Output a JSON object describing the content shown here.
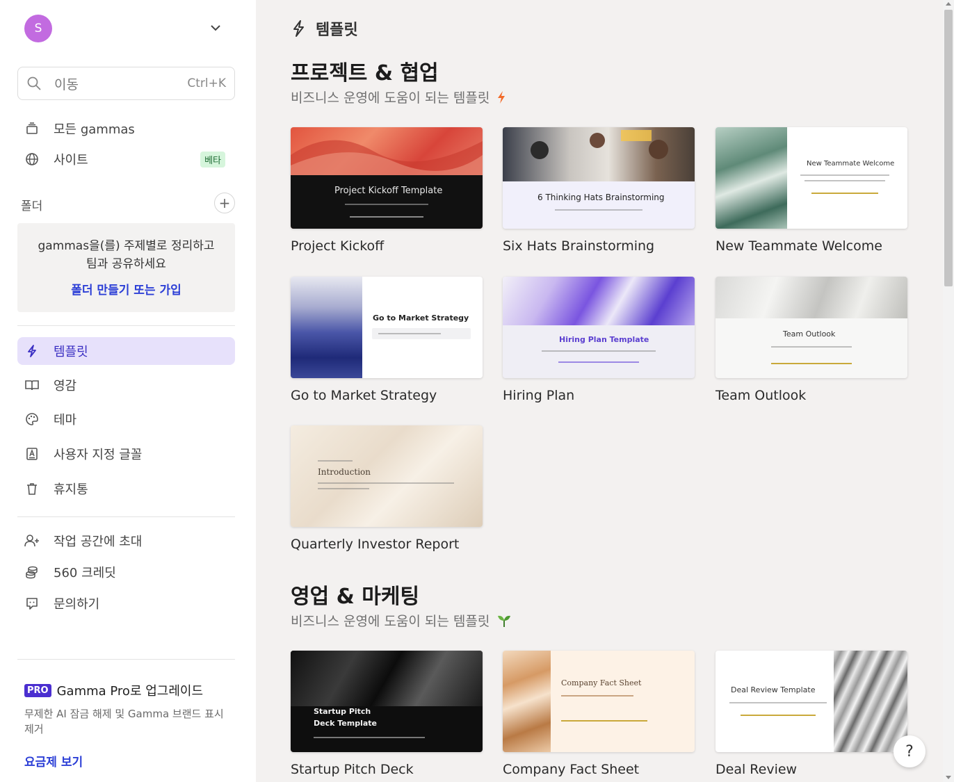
{
  "workspace": {
    "avatar_letter": "S"
  },
  "search": {
    "placeholder": "이동",
    "shortcut": "Ctrl+K"
  },
  "nav_top": [
    {
      "label": "모든 gammas",
      "icon": "stack-icon"
    },
    {
      "label": "사이트",
      "icon": "globe-icon",
      "badge": "베타"
    }
  ],
  "folders": {
    "label": "폴더",
    "empty_line1": "gammas을(를) 주제별로 정리하고",
    "empty_line2": "팀과 공유하세요",
    "create_link": "폴더 만들기 또는 가입"
  },
  "nav_main": [
    {
      "label": "템플릿",
      "icon": "bolt-icon",
      "active": true
    },
    {
      "label": "영감",
      "icon": "book-icon"
    },
    {
      "label": "테마",
      "icon": "palette-icon"
    },
    {
      "label": "사용자 지정 글꼴",
      "icon": "font-icon"
    },
    {
      "label": "휴지통",
      "icon": "trash-icon"
    }
  ],
  "nav_bottom": [
    {
      "label": "작업 공간에 초대",
      "icon": "user-plus-icon"
    },
    {
      "label": "560 크레딧",
      "icon": "coins-icon"
    },
    {
      "label": "문의하기",
      "icon": "chat-icon"
    }
  ],
  "pro": {
    "badge": "PRO",
    "title": "Gamma Pro로 업그레이드",
    "desc": "무제한 AI 잠금 해제 및 Gamma 브랜드 표시 제거",
    "link": "요금제 보기"
  },
  "page": {
    "title": "템플릿"
  },
  "sections": [
    {
      "title": "프로젝트 & 협업",
      "subtitle": "비즈니스 운영에 도움이 되는 템플릿",
      "cards": [
        {
          "label": "Project Kickoff",
          "thumb_title": "Project Kickoff Template"
        },
        {
          "label": "Six Hats Brainstorming",
          "thumb_title": "6 Thinking Hats Brainstorming"
        },
        {
          "label": "New Teammate Welcome",
          "thumb_title": "New Teammate Welcome"
        },
        {
          "label": "Go to Market Strategy",
          "thumb_title": "Go to Market Strategy"
        },
        {
          "label": "Hiring Plan",
          "thumb_title": "Hiring Plan Template"
        },
        {
          "label": "Team Outlook",
          "thumb_title": "Team Outlook"
        },
        {
          "label": "Quarterly Investor Report",
          "thumb_title": "Introduction"
        }
      ]
    },
    {
      "title": "영업 & 마케팅",
      "subtitle": "비즈니스 운영에 도움이 되는 템플릿",
      "cards": [
        {
          "label": "Startup Pitch Deck",
          "thumb_title": "Startup Pitch",
          "thumb_title2": "Deck Template"
        },
        {
          "label": "Company Fact Sheet",
          "thumb_title": "Company Fact Sheet"
        },
        {
          "label": "Deal Review",
          "thumb_title": "Deal Review Template"
        }
      ]
    }
  ],
  "help": {
    "label": "?"
  },
  "colors": {
    "accent": "#3a2ec2",
    "active_bg": "#e7e1fb",
    "link": "#2c3fd6",
    "pro": "#4b2fd0"
  }
}
